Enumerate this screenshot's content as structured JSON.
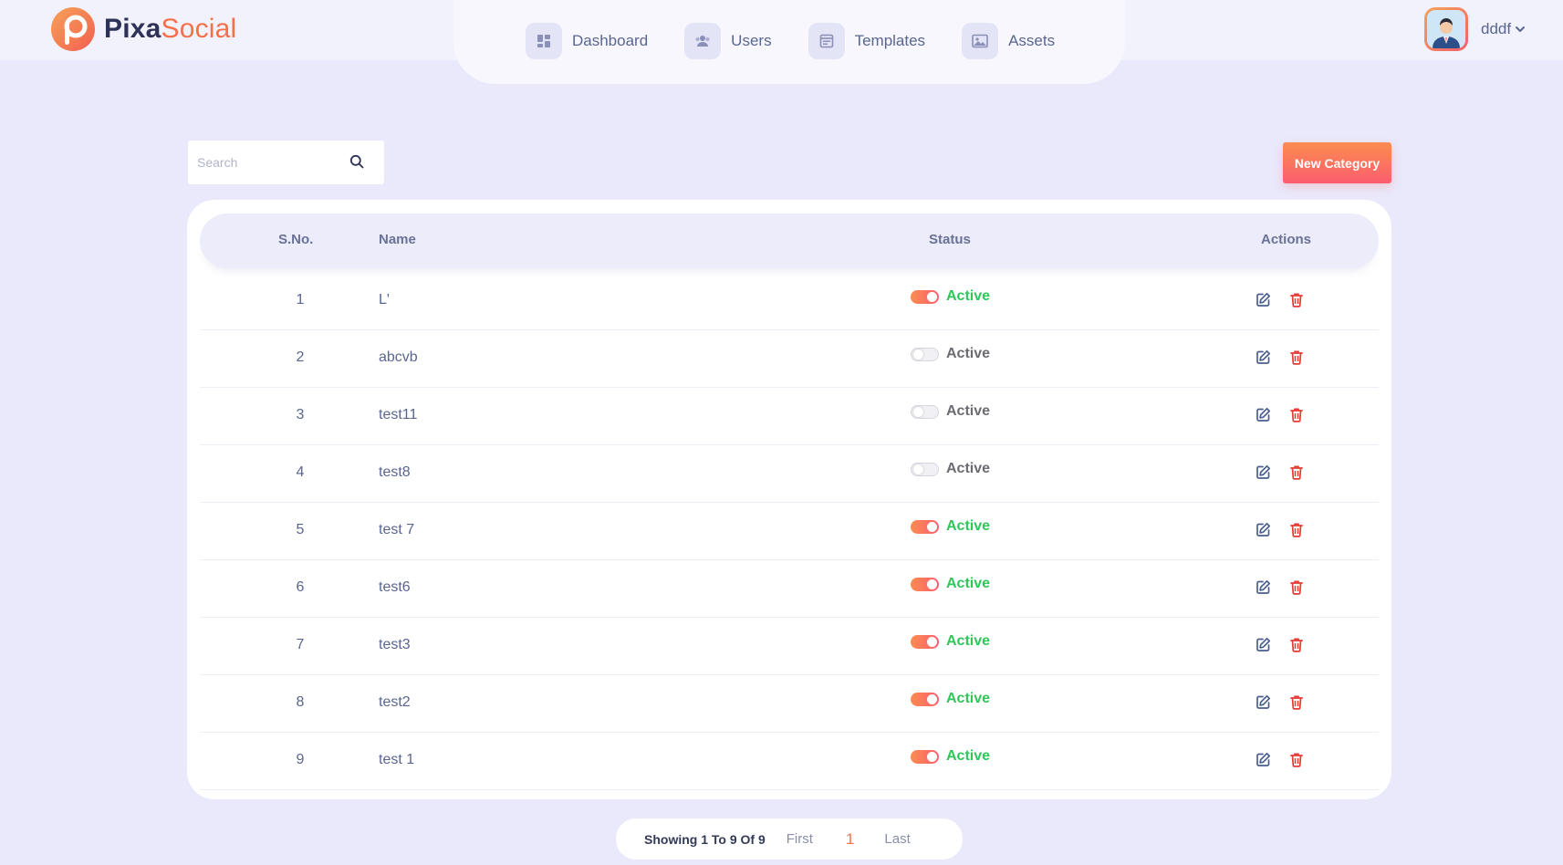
{
  "brand": {
    "name_part1": "Pixa",
    "name_part2": "Social"
  },
  "nav": [
    {
      "label": "Dashboard",
      "icon": "dashboard-icon"
    },
    {
      "label": "Users",
      "icon": "users-icon"
    },
    {
      "label": "Templates",
      "icon": "templates-icon"
    },
    {
      "label": "Assets",
      "icon": "image-icon"
    }
  ],
  "user": {
    "name": "dddf"
  },
  "search": {
    "placeholder": "Search",
    "value": ""
  },
  "toolbar": {
    "new_category_label": "New Category"
  },
  "table": {
    "headers": {
      "sno": "S.No.",
      "name": "Name",
      "status": "Status",
      "actions": "Actions"
    },
    "rows": [
      {
        "sno": "1",
        "name": "L'",
        "status": "Active",
        "enabled": true
      },
      {
        "sno": "2",
        "name": "abcvb",
        "status": "Active",
        "enabled": false
      },
      {
        "sno": "3",
        "name": "test11",
        "status": "Active",
        "enabled": false
      },
      {
        "sno": "4",
        "name": "test8",
        "status": "Active",
        "enabled": false
      },
      {
        "sno": "5",
        "name": "test 7",
        "status": "Active",
        "enabled": true
      },
      {
        "sno": "6",
        "name": "test6",
        "status": "Active",
        "enabled": true
      },
      {
        "sno": "7",
        "name": "test3",
        "status": "Active",
        "enabled": true
      },
      {
        "sno": "8",
        "name": "test2",
        "status": "Active",
        "enabled": true
      },
      {
        "sno": "9",
        "name": "test 1",
        "status": "Active",
        "enabled": true
      }
    ]
  },
  "pagination": {
    "info": "Showing 1 To 9 Of 9",
    "first": "First",
    "current": "1",
    "last": "Last"
  },
  "colors": {
    "accent": "#f4704a",
    "active_green": "#2fc65a",
    "delete_red": "#e53935",
    "background": "#e9e9fb"
  }
}
